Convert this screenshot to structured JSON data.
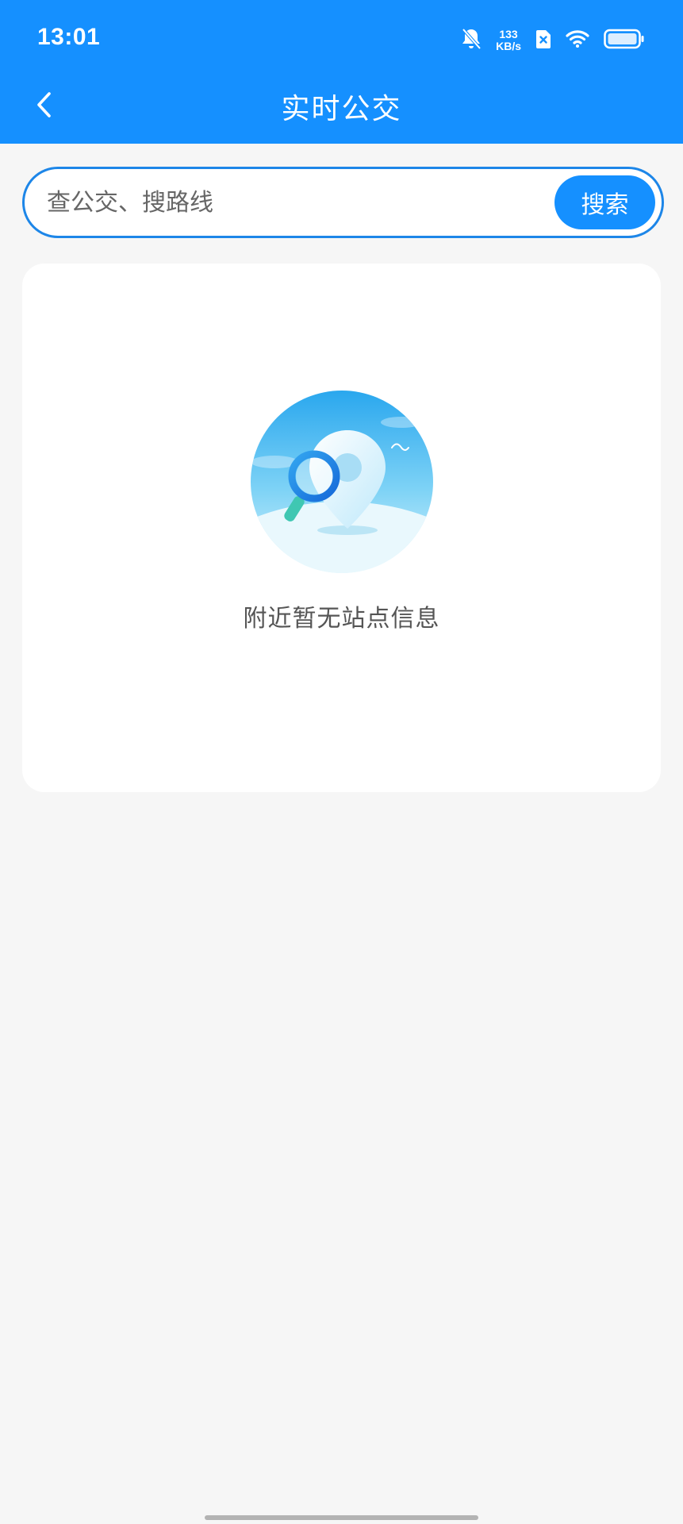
{
  "status_bar": {
    "time": "13:01",
    "net_speed_value": "133",
    "net_speed_unit": "KB/s",
    "icons": [
      "mute-bell-icon",
      "sim-no-signal-icon",
      "wifi-icon",
      "battery-icon"
    ]
  },
  "header": {
    "title": "实时公交",
    "back_icon": "chevron-left-icon"
  },
  "search": {
    "placeholder": "查公交、搜路线",
    "value": "",
    "button_label": "搜索"
  },
  "empty_state": {
    "message": "附近暂无站点信息",
    "illustration": "location-pin-magnifier-icon"
  },
  "colors": {
    "primary": "#1590ff",
    "border": "#1d86e8",
    "background": "#f6f6f6",
    "card": "#ffffff"
  }
}
